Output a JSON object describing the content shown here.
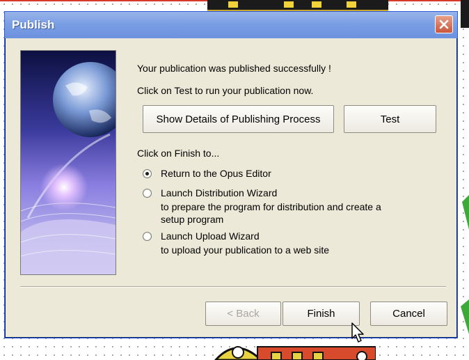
{
  "window": {
    "title": "Publish"
  },
  "messages": {
    "success": "Your publication was published successfully !",
    "test_hint": "Click on Test to run your publication now.",
    "finish_hint": "Click on Finish to..."
  },
  "buttons": {
    "show_details": "Show Details of Publishing Process",
    "test": "Test",
    "back": "< Back",
    "finish": "Finish",
    "cancel": "Cancel"
  },
  "options": [
    {
      "label": "Return to the Opus Editor",
      "checked": true,
      "description": []
    },
    {
      "label": "Launch Distribution Wizard",
      "checked": false,
      "description": [
        "to prepare the program for distribution and create a",
        "setup program"
      ]
    },
    {
      "label": "Launch Upload Wizard",
      "checked": false,
      "description": [
        "to upload your publication to a web site"
      ]
    }
  ],
  "colors": {
    "titlebar": "#7b9ee4",
    "dialog_bg": "#ece9d8",
    "close_button": "#c8563c"
  },
  "icons": {
    "close": "close-icon",
    "image": "globe-book-illustration",
    "cursor": "mouse-pointer-icon"
  }
}
